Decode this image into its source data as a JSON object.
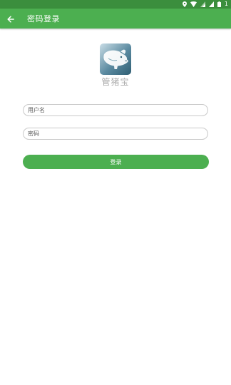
{
  "status_bar": {
    "battery_text": "1",
    "icons": [
      "location-icon",
      "wifi-icon",
      "signal-icon",
      "signal-icon",
      "battery-icon"
    ]
  },
  "app_bar": {
    "title": "密码登录",
    "back_icon": "arrow-left-icon"
  },
  "logo": {
    "name": "管猪宝",
    "icon": "pig-logo-icon"
  },
  "form": {
    "username_placeholder": "用户名",
    "username_value": "",
    "password_placeholder": "密码",
    "password_value": "",
    "login_label": "登录"
  },
  "colors": {
    "status_bar": "#3b8e3d",
    "primary": "#4caf50",
    "app_name_text": "#a9a9a9",
    "field_border": "#c9c9c9"
  }
}
